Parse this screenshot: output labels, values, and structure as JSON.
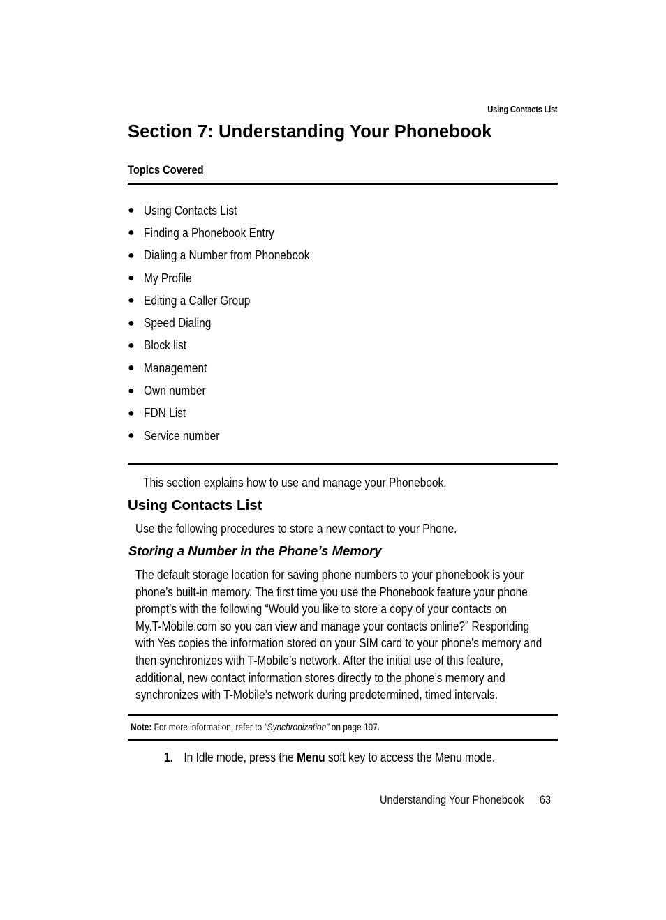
{
  "running_header": "Using Contacts List",
  "page_title": "Section 7: Understanding Your Phonebook",
  "topics": {
    "label": "Topics Covered",
    "items": [
      "Using Contacts List",
      "Finding a Phonebook Entry",
      "Dialing a Number from Phonebook",
      "My Profile",
      "Editing a Caller Group",
      "Speed Dialing",
      "Block list",
      "Management",
      "Own number",
      "FDN List",
      "Service number"
    ]
  },
  "intro": "This section explains how to use and manage your Phonebook.",
  "section": {
    "heading": "Using Contacts List",
    "intro": "Use the following procedures to store a new contact to your Phone.",
    "subheading": "Storing a Number in the Phone’s Memory",
    "paragraph_lines": [
      "The default storage location for saving phone numbers to your phonebook is your",
      "phone’s built-in memory. The first time you use the Phonebook feature your phone",
      "prompt’s with the following “Would you like to store a copy of your contacts on",
      "My.T-Mobile.com so you can view and manage your contacts online?” Responding",
      "with Yes copies the information stored on your SIM card to your phone’s memory and",
      "then synchronizes with T-Mobile’s network. After the initial use of this feature,",
      "additional, new contact information stores directly to the phone’s memory and",
      "synchronizes with T-Mobile’s network during predetermined, timed intervals."
    ]
  },
  "note": {
    "label": "Note:",
    "text_before": " For more information, refer to ",
    "link": "\"Synchronization\"",
    "text_after": "  on page 107."
  },
  "steps": [
    {
      "number": "1.",
      "text_before": "In Idle mode, press the ",
      "bold": "Menu",
      "text_after": " soft key to access the Menu mode."
    }
  ],
  "footer": {
    "title": "Understanding Your Phonebook",
    "page_number": "63"
  }
}
